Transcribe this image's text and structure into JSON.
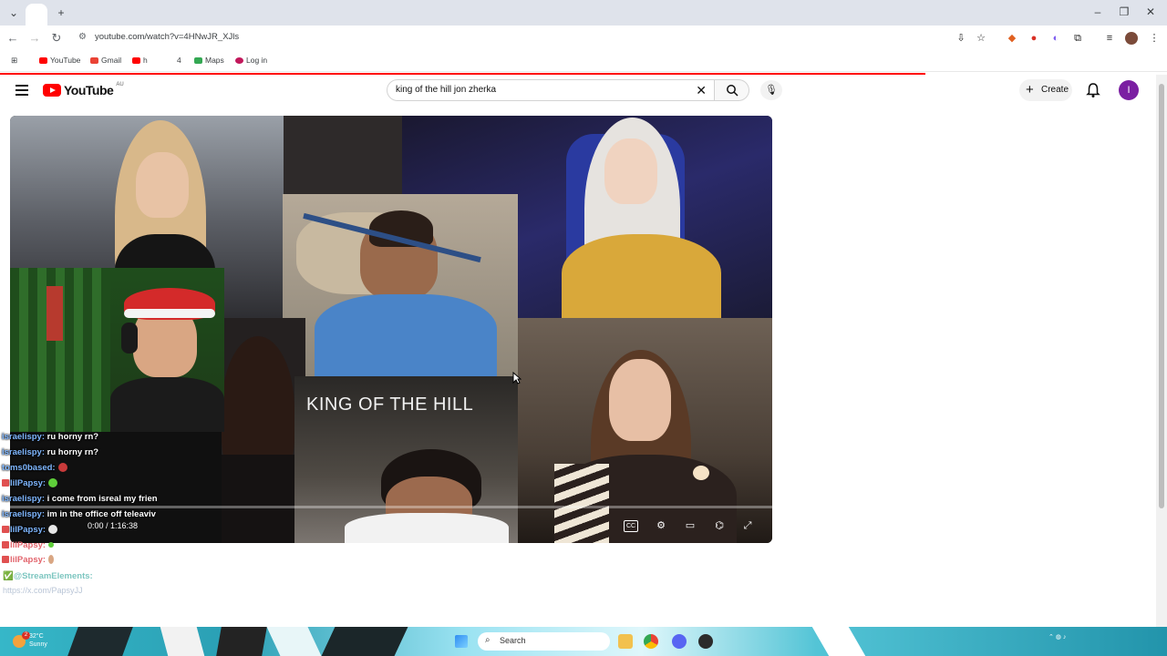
{
  "browser": {
    "url": "youtube.com/watch?v=4HNwJR_XJls",
    "bookmarks": [
      {
        "label": "YouTube"
      },
      {
        "label": "Gmail"
      },
      {
        "label": "h"
      },
      {
        "label": "4"
      },
      {
        "label": "Maps"
      },
      {
        "label": "Log in"
      }
    ]
  },
  "youtube": {
    "logo_text": "YouTube",
    "logo_region": "AU",
    "search_query": "king of the hill jon zherka",
    "create_label": "Create",
    "avatar_letter": "I"
  },
  "video": {
    "overlay_title": "KING OF THE HILL",
    "time": "0:00 / 1:16:38",
    "progress": 0
  },
  "chat": {
    "lines": [
      {
        "user": "israelispy:",
        "message": "ru horny rn?"
      },
      {
        "user": "israelispy:",
        "message": "ru horny rn?"
      },
      {
        "user": "toms0based:",
        "message": ""
      },
      {
        "user": "lilPapsy:",
        "message": ""
      },
      {
        "user": "israelispy:",
        "message": "i come from isreal my frien"
      },
      {
        "user": "israelispy:",
        "message": "im in the office off teleaviv"
      },
      {
        "user": "lilPapsy:",
        "message": ""
      },
      {
        "user": "lilPapsy:",
        "message": ""
      },
      {
        "user": "lilPapsy:",
        "message": ""
      }
    ],
    "streamelements": "✅@StreamElements:",
    "link": "https://x.com/PapsyJJ"
  },
  "taskbar": {
    "weather_temp": "32°C",
    "weather_desc": "Sunny",
    "search_label": "Search",
    "notif_count": "2"
  },
  "colors": {
    "youtube_red": "#ff0000",
    "chat_user": "#7fb7ff",
    "avatar_bg": "#7b1fa2"
  }
}
